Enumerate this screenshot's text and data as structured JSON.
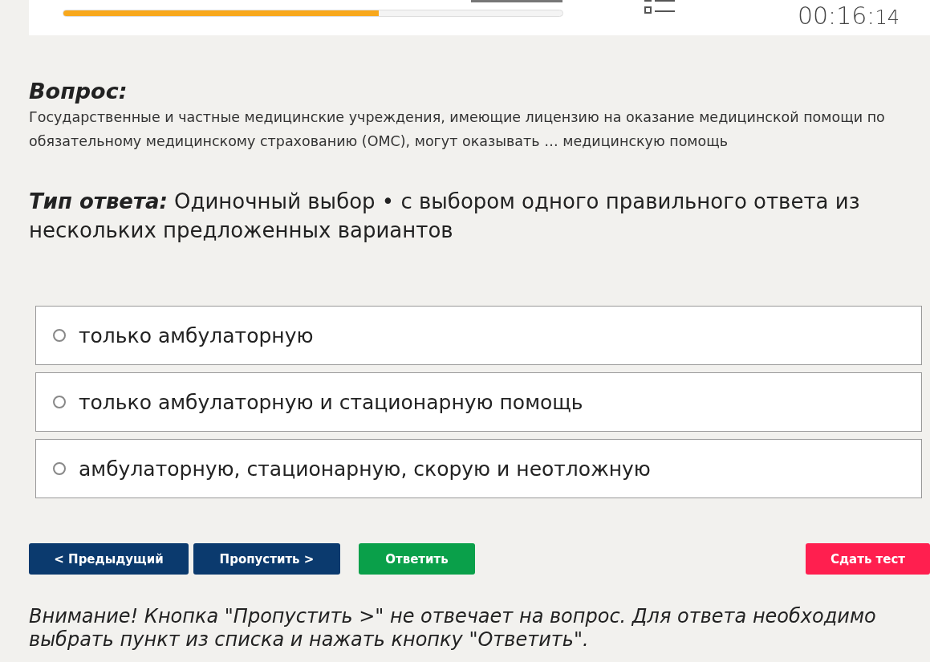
{
  "header": {
    "progress": {
      "level": 0.632
    },
    "timer": {
      "main": "00:16:",
      "seconds": "14"
    }
  },
  "question": {
    "label": "Вопрос:",
    "text": "Государственные и частные медицинские учреждения, имеющие лицензию на оказание медицинской помощи по обязательному медицинскому страхованию (ОМС), могут оказывать … медицинскую помощь"
  },
  "answer_type": {
    "label": "Тип ответа:",
    "text": "Одиночный выбор • с выбором одного правильного ответа из нескольких предложенных вариантов"
  },
  "options": [
    {
      "text": "только амбулаторную",
      "selected": false
    },
    {
      "text": "только амбулаторную и стационарную помощь",
      "selected": false
    },
    {
      "text": "амбулаторную, стационарную, скорую и неотложную",
      "selected": false
    }
  ],
  "buttons": [
    {
      "kind": "prev",
      "label": "< Предыдущий"
    },
    {
      "kind": "skip",
      "label": "Пропустить >"
    },
    {
      "kind": "answer",
      "label": "Ответить"
    },
    {
      "kind": "submit",
      "label": "Сдать тест"
    }
  ],
  "notice": "Внимание! Кнопка \"Пропустить >\" не отвечает на вопрос. Для ответа необходимо выбрать пункт из списка и нажать кнопку \"Ответить\"."
}
